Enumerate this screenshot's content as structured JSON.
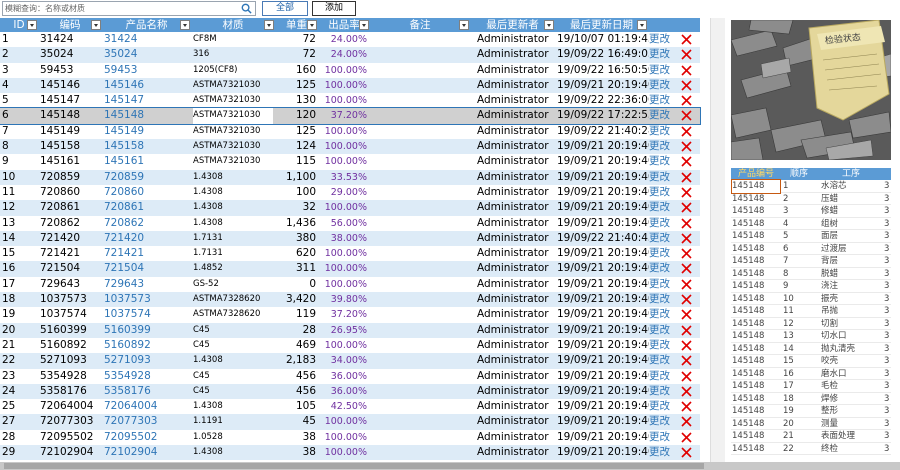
{
  "toolbar": {
    "search_placeholder": "模糊查询：名称或材质",
    "btn_all": "全部",
    "btn_add": "添加",
    "search_icon": "search-icon"
  },
  "grid": {
    "headers": {
      "id": "ID",
      "code": "编码",
      "name": "产品名称",
      "material": "材质",
      "price": "单重",
      "rate": "出品率",
      "remark": "备注",
      "updater": "最后更新者",
      "updated": "最后更新日期"
    },
    "edit_label": "更改",
    "delete_icon": "close-icon",
    "rows": [
      {
        "id": "1",
        "code": "31424",
        "name": "31424",
        "material": "CF8M",
        "price": "72",
        "rate": "24.00%",
        "updater": "Administrator",
        "updated": "19/10/07 01:19:43"
      },
      {
        "id": "2",
        "code": "35024",
        "name": "35024",
        "material": "316",
        "price": "72",
        "rate": "24.00%",
        "updater": "Administrator",
        "updated": "19/09/22 16:49:03"
      },
      {
        "id": "3",
        "code": "59453",
        "name": "59453",
        "material": "1205(CF8)",
        "price": "160",
        "rate": "100.00%",
        "updater": "Administrator",
        "updated": "19/09/22 16:50:50"
      },
      {
        "id": "4",
        "code": "145146",
        "name": "145146",
        "material": "ASTMA7321030",
        "price": "125",
        "rate": "100.00%",
        "updater": "Administrator",
        "updated": "19/09/21 20:19:40"
      },
      {
        "id": "5",
        "code": "145147",
        "name": "145147",
        "material": "ASTMA7321030",
        "price": "130",
        "rate": "100.00%",
        "updater": "Administrator",
        "updated": "19/09/22 22:36:06"
      },
      {
        "id": "6",
        "code": "145148",
        "name": "145148",
        "material": "ASTMA7321030",
        "price": "120",
        "rate": "37.20%",
        "updater": "Administrator",
        "updated": "19/09/22 17:22:53"
      },
      {
        "id": "7",
        "code": "145149",
        "name": "145149",
        "material": "ASTMA7321030",
        "price": "125",
        "rate": "100.00%",
        "updater": "Administrator",
        "updated": "19/09/22 21:40:28"
      },
      {
        "id": "8",
        "code": "145158",
        "name": "145158",
        "material": "ASTMA7321030",
        "price": "124",
        "rate": "100.00%",
        "updater": "Administrator",
        "updated": "19/09/21 20:19:40"
      },
      {
        "id": "9",
        "code": "145161",
        "name": "145161",
        "material": "ASTMA7321030",
        "price": "115",
        "rate": "100.00%",
        "updater": "Administrator",
        "updated": "19/09/21 20:19:40"
      },
      {
        "id": "10",
        "code": "720859",
        "name": "720859",
        "material": "1.4308",
        "price": "1,100",
        "rate": "33.53%",
        "updater": "Administrator",
        "updated": "19/09/21 20:19:40"
      },
      {
        "id": "11",
        "code": "720860",
        "name": "720860",
        "material": "1.4308",
        "price": "100",
        "rate": "29.00%",
        "updater": "Administrator",
        "updated": "19/09/21 20:19:40"
      },
      {
        "id": "12",
        "code": "720861",
        "name": "720861",
        "material": "1.4308",
        "price": "32",
        "rate": "100.00%",
        "updater": "Administrator",
        "updated": "19/09/21 20:19:40"
      },
      {
        "id": "13",
        "code": "720862",
        "name": "720862",
        "material": "1.4308",
        "price": "1,436",
        "rate": "56.00%",
        "updater": "Administrator",
        "updated": "19/09/21 20:19:40"
      },
      {
        "id": "14",
        "code": "721420",
        "name": "721420",
        "material": "1.7131",
        "price": "380",
        "rate": "38.00%",
        "updater": "Administrator",
        "updated": "19/09/22 21:40:45"
      },
      {
        "id": "15",
        "code": "721421",
        "name": "721421",
        "material": "1.7131",
        "price": "620",
        "rate": "100.00%",
        "updater": "Administrator",
        "updated": "19/09/21 20:19:40"
      },
      {
        "id": "16",
        "code": "721504",
        "name": "721504",
        "material": "1.4852",
        "price": "311",
        "rate": "100.00%",
        "updater": "Administrator",
        "updated": "19/09/21 20:19:40"
      },
      {
        "id": "17",
        "code": "729643",
        "name": "729643",
        "material": "GS-52",
        "price": "0",
        "rate": "100.00%",
        "updater": "Administrator",
        "updated": "19/09/21 20:19:40"
      },
      {
        "id": "18",
        "code": "1037573",
        "name": "1037573",
        "material": "ASTMA7328620",
        "price": "3,420",
        "rate": "39.80%",
        "updater": "Administrator",
        "updated": "19/09/21 20:19:40"
      },
      {
        "id": "19",
        "code": "1037574",
        "name": "1037574",
        "material": "ASTMA7328620",
        "price": "119",
        "rate": "37.20%",
        "updater": "Administrator",
        "updated": "19/09/21 20:19:40"
      },
      {
        "id": "20",
        "code": "5160399",
        "name": "5160399",
        "material": "C45",
        "price": "28",
        "rate": "26.95%",
        "updater": "Administrator",
        "updated": "19/09/21 20:19:40"
      },
      {
        "id": "21",
        "code": "5160892",
        "name": "5160892",
        "material": "C45",
        "price": "469",
        "rate": "100.00%",
        "updater": "Administrator",
        "updated": "19/09/21 20:19:40"
      },
      {
        "id": "22",
        "code": "5271093",
        "name": "5271093",
        "material": "1.4308",
        "price": "2,183",
        "rate": "34.00%",
        "updater": "Administrator",
        "updated": "19/09/21 20:19:40"
      },
      {
        "id": "23",
        "code": "5354928",
        "name": "5354928",
        "material": "C45",
        "price": "456",
        "rate": "36.00%",
        "updater": "Administrator",
        "updated": "19/09/21 20:19:40"
      },
      {
        "id": "24",
        "code": "5358176",
        "name": "5358176",
        "material": "C45",
        "price": "456",
        "rate": "36.00%",
        "updater": "Administrator",
        "updated": "19/09/21 20:19:40"
      },
      {
        "id": "25",
        "code": "72064004",
        "name": "72064004",
        "material": "1.4308",
        "price": "105",
        "rate": "42.50%",
        "updater": "Administrator",
        "updated": "19/09/21 20:19:40"
      },
      {
        "id": "27",
        "code": "72077303",
        "name": "72077303",
        "material": "1.1191",
        "price": "45",
        "rate": "100.00%",
        "updater": "Administrator",
        "updated": "19/09/21 20:19:40"
      },
      {
        "id": "28",
        "code": "72095502",
        "name": "72095502",
        "material": "1.0528",
        "price": "38",
        "rate": "100.00%",
        "updater": "Administrator",
        "updated": "19/09/21 20:19:40"
      },
      {
        "id": "29",
        "code": "72102904",
        "name": "72102904",
        "material": "1.4308",
        "price": "38",
        "rate": "100.00%",
        "updater": "Administrator",
        "updated": "19/09/21 20:19:40"
      }
    ],
    "selected_index": 5
  },
  "photo": {
    "label_text": "检验状态"
  },
  "process": {
    "headers": {
      "code": "产品编号",
      "seq": "顺序",
      "step": "工序"
    },
    "product_code": "145148",
    "trailing_digit": "3",
    "steps": [
      "水溶芯",
      "压蜡",
      "修蜡",
      "组树",
      "面层",
      "过渡层",
      "背层",
      "脱蜡",
      "浇注",
      "振壳",
      "吊抛",
      "切割",
      "切水口",
      "抛丸清壳",
      "咬壳",
      "磨水口",
      "毛检",
      "焊修",
      "整形",
      "测量",
      "表面处理",
      "终检"
    ]
  },
  "colors": {
    "header_blue": "#5b9bd5",
    "alt_row": "#ddebf7",
    "link_blue": "#2e75b6",
    "rate_purple": "#7030a0",
    "delete_red": "#e00000"
  }
}
